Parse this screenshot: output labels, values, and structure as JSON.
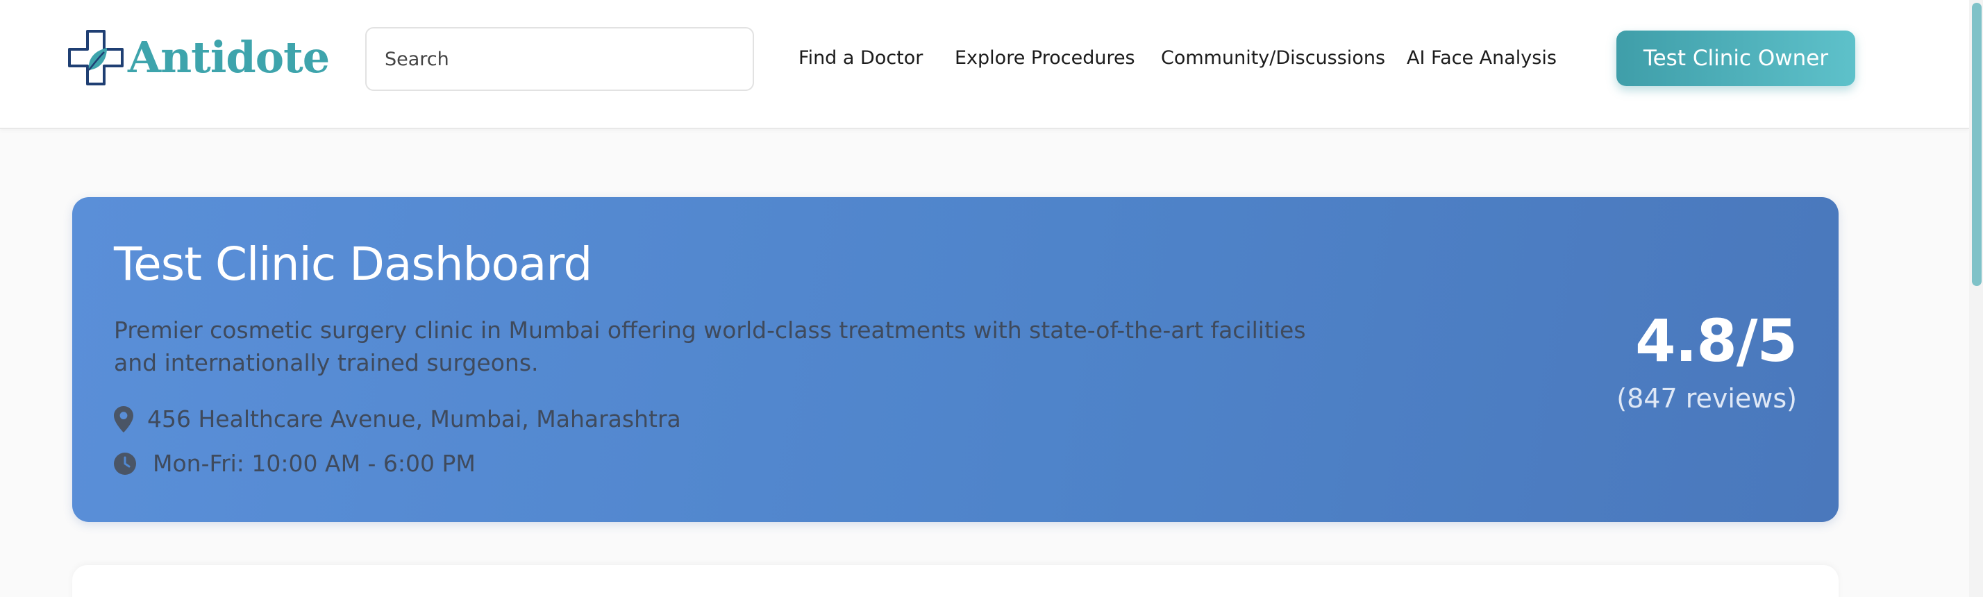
{
  "header": {
    "logo_text": "Antidote",
    "search_placeholder": "Search",
    "nav": [
      "Find a Doctor",
      "Explore Procedures",
      "Community/Discussions",
      "AI Face Analysis"
    ],
    "user_button": "Test Clinic Owner"
  },
  "clinic": {
    "title": "Test Clinic Dashboard",
    "description": "Premier cosmetic surgery clinic in Mumbai offering world-class treatments with state-of-the-art facilities and internationally trained surgeons.",
    "address": "456 Healthcare Avenue, Mumbai, Maharashtra",
    "hours": "Mon-Fri: 10:00 AM - 6:00 PM",
    "rating": "4.8/5",
    "reviews": "(847 reviews)"
  },
  "icons": {
    "logo": "medical-cross-leaf-icon",
    "address": "map-pin-icon",
    "hours": "clock-icon"
  },
  "colors": {
    "brand_teal": "#3ea4ac",
    "card_blue": "#5189d2",
    "logo_navy": "#1f3f73",
    "secondary_text": "#3f4a5c"
  }
}
